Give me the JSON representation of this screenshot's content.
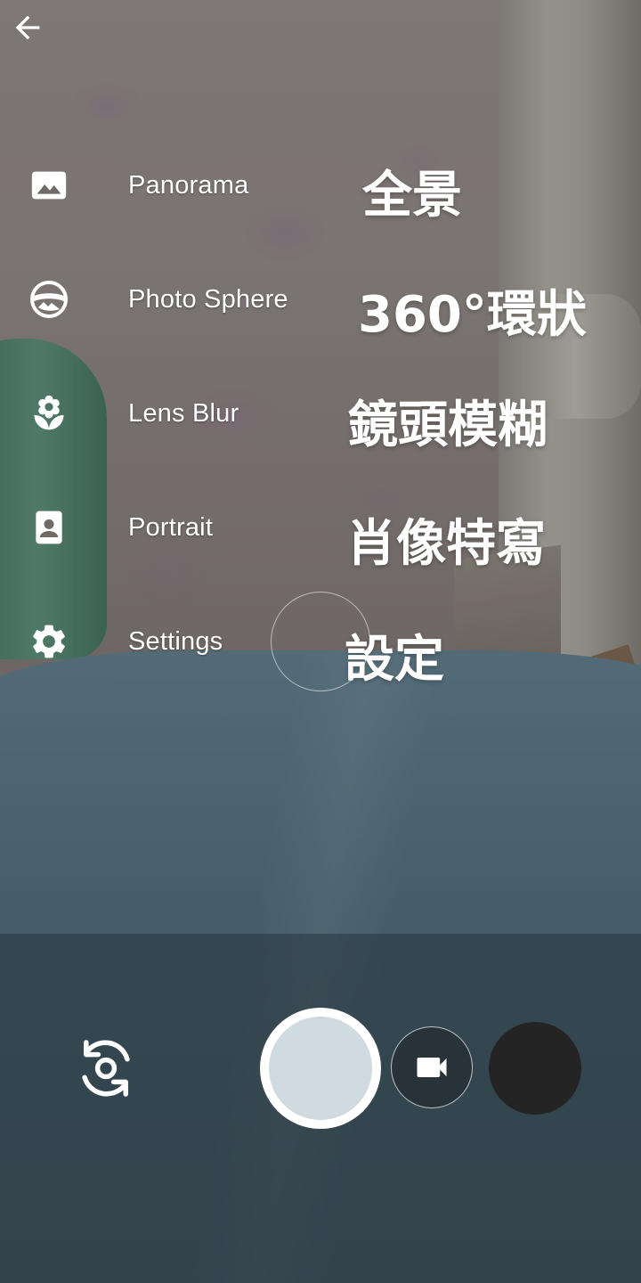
{
  "navigation": {
    "back_icon": "arrow-back-icon"
  },
  "modes": [
    {
      "id": "panorama",
      "label": "Panorama",
      "annotation": "全景",
      "icon": "panorama-icon"
    },
    {
      "id": "photo-sphere",
      "label": "Photo Sphere",
      "annotation": "360°環狀",
      "icon": "photo-sphere-icon"
    },
    {
      "id": "lens-blur",
      "label": "Lens Blur",
      "annotation": "鏡頭模糊",
      "icon": "lens-blur-icon"
    },
    {
      "id": "portrait",
      "label": "Portrait",
      "annotation": "肖像特寫",
      "icon": "portrait-icon"
    },
    {
      "id": "settings",
      "label": "Settings",
      "annotation": "設定",
      "icon": "gear-icon"
    }
  ],
  "controls": {
    "switch_camera_icon": "switch-camera-icon",
    "shutter_icon": "shutter-button",
    "video_icon": "video-camera-icon",
    "thumbnail": "gallery-thumbnail"
  },
  "colors": {
    "text": "#ffffff",
    "shutter_inner": "#cfdbe0",
    "thumbnail": "#242424"
  }
}
